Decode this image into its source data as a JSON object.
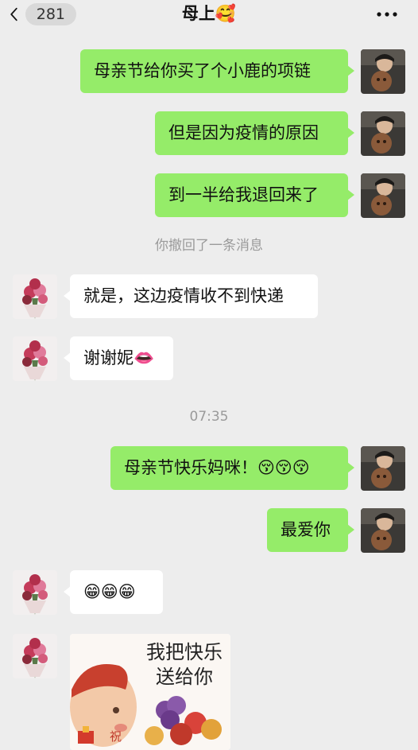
{
  "header": {
    "unread_count": "281",
    "title": "母上🥰",
    "icons": {
      "back": "chevron-left-icon",
      "more": "more-dots-icon"
    }
  },
  "messages": [
    {
      "side": "right",
      "text": "母亲节给你买了个小鹿的项链"
    },
    {
      "side": "right",
      "text": "但是因为疫情的原因"
    },
    {
      "side": "right",
      "text": "到一半给我退回来了"
    },
    {
      "type": "system",
      "text": "你撤回了一条消息"
    },
    {
      "side": "left",
      "text": "就是，这边疫情收不到快递"
    },
    {
      "side": "left",
      "text": "谢谢妮👄"
    },
    {
      "type": "time",
      "text": "07:35"
    },
    {
      "side": "right",
      "text": "母亲节快乐妈咪！😚😚😚"
    },
    {
      "side": "right",
      "text": "最爱你"
    },
    {
      "side": "left",
      "text": "😁😁😁"
    },
    {
      "side": "left",
      "type": "sticker",
      "caption_line1": "我把快乐",
      "caption_line2": "送给你",
      "stamp": "祝"
    }
  ],
  "colors": {
    "background": "#ededed",
    "bubble_self": "#95ec69",
    "bubble_other": "#ffffff",
    "system_text": "#9a9a9a"
  }
}
